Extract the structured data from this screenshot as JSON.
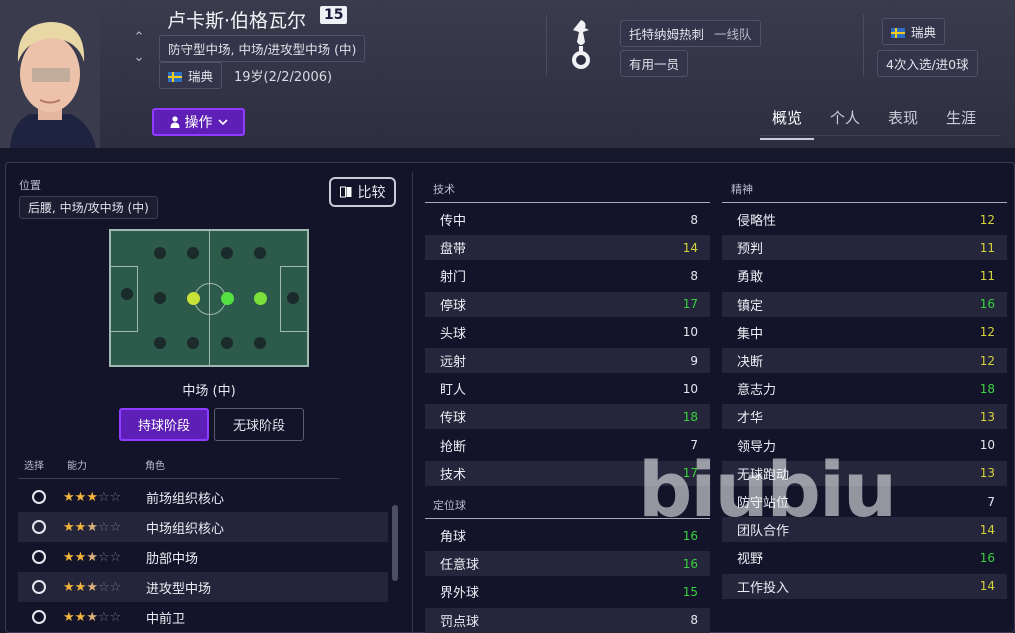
{
  "player": {
    "name": "卢卡斯·伯格瓦尔",
    "shirt_number": "15",
    "positions": "防守型中场, 中场/进攻型中场 (中)",
    "nationality": "瑞典",
    "age_dob": "19岁(2/2/2006)"
  },
  "club": {
    "name": "托特纳姆热刺",
    "squad": "一线队",
    "status": "有用一员"
  },
  "international": {
    "nation": "瑞典",
    "caps": "4次入选/进0球"
  },
  "action_button": "操作",
  "tabs": [
    "概览",
    "个人",
    "表现",
    "生涯"
  ],
  "active_tab": "概览",
  "position_panel": {
    "label": "位置",
    "value": "后腰, 中场/攻中场 (中)",
    "compare_button": "比较",
    "selected_position": "中场 (中)",
    "mode_in_possession": "持球阶段",
    "mode_out_possession": "无球阶段",
    "active_mode": "持球阶段"
  },
  "roles": {
    "headers": {
      "select": "选择",
      "ability": "能力",
      "role": "角色"
    },
    "items": [
      {
        "name": "前场组织核心",
        "stars": 3
      },
      {
        "name": "中场组织核心",
        "stars": 2.5
      },
      {
        "name": "肋部中场",
        "stars": 2.5
      },
      {
        "name": "进攻型中场",
        "stars": 2.5
      },
      {
        "name": "中前卫",
        "stars": 2.5
      }
    ]
  },
  "attributes": {
    "technical_title": "技术",
    "technical": [
      {
        "name": "传中",
        "value": "8"
      },
      {
        "name": "盘带",
        "value": "14"
      },
      {
        "name": "射门",
        "value": "8"
      },
      {
        "name": "停球",
        "value": "17"
      },
      {
        "name": "头球",
        "value": "10"
      },
      {
        "name": "远射",
        "value": "9"
      },
      {
        "name": "盯人",
        "value": "10"
      },
      {
        "name": "传球",
        "value": "18"
      },
      {
        "name": "抢断",
        "value": "7"
      },
      {
        "name": "技术",
        "value": "17"
      }
    ],
    "setpiece_title": "定位球",
    "setpieces": [
      {
        "name": "角球",
        "value": "16"
      },
      {
        "name": "任意球",
        "value": "16"
      },
      {
        "name": "界外球",
        "value": "15"
      },
      {
        "name": "罚点球",
        "value": "8"
      }
    ],
    "mental_title": "精神",
    "mental": [
      {
        "name": "侵略性",
        "value": "12"
      },
      {
        "name": "预判",
        "value": "11"
      },
      {
        "name": "勇敢",
        "value": "11"
      },
      {
        "name": "镇定",
        "value": "16"
      },
      {
        "name": "集中",
        "value": "12"
      },
      {
        "name": "决断",
        "value": "12"
      },
      {
        "name": "意志力",
        "value": "18"
      },
      {
        "name": "才华",
        "value": "13"
      },
      {
        "name": "领导力",
        "value": "10"
      },
      {
        "name": "无球跑动",
        "value": "13"
      },
      {
        "name": "防守站位",
        "value": "7"
      },
      {
        "name": "团队合作",
        "value": "14"
      },
      {
        "name": "视野",
        "value": "16"
      },
      {
        "name": "工作投入",
        "value": "14"
      }
    ]
  },
  "colors": {
    "accent_purple": "#8e3cff",
    "green_attr": "#37d23d",
    "yellow_attr": "#d4d23a",
    "white_attr": "#e6e8f0"
  },
  "watermark": "biubiu"
}
